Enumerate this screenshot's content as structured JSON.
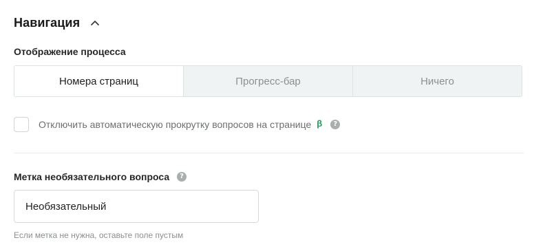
{
  "navigation": {
    "title": "Навигация",
    "toggle_icon": "chevron-up-icon"
  },
  "process_display": {
    "label": "Отображение процесса",
    "options": [
      {
        "label": "Номера страниц",
        "selected": true
      },
      {
        "label": "Прогресс-бар",
        "selected": false
      },
      {
        "label": "Ничего",
        "selected": false
      }
    ]
  },
  "autoscroll": {
    "label": "Отключить автоматическую прокрутку вопросов на странице",
    "checked": false,
    "beta_badge": "β",
    "help_icon": "question-circle-icon"
  },
  "optional_label": {
    "label": "Метка необязательного вопроса",
    "help_icon": "question-circle-icon",
    "value": "Необязательный",
    "hint": "Если метка не нужна, оставьте поле пустым"
  },
  "colors": {
    "beta": "#1a9e5a",
    "segment_active_bg": "#ffffff",
    "segment_inactive_bg": "#eff3f3",
    "help_icon_bg": "#a9aeae"
  }
}
